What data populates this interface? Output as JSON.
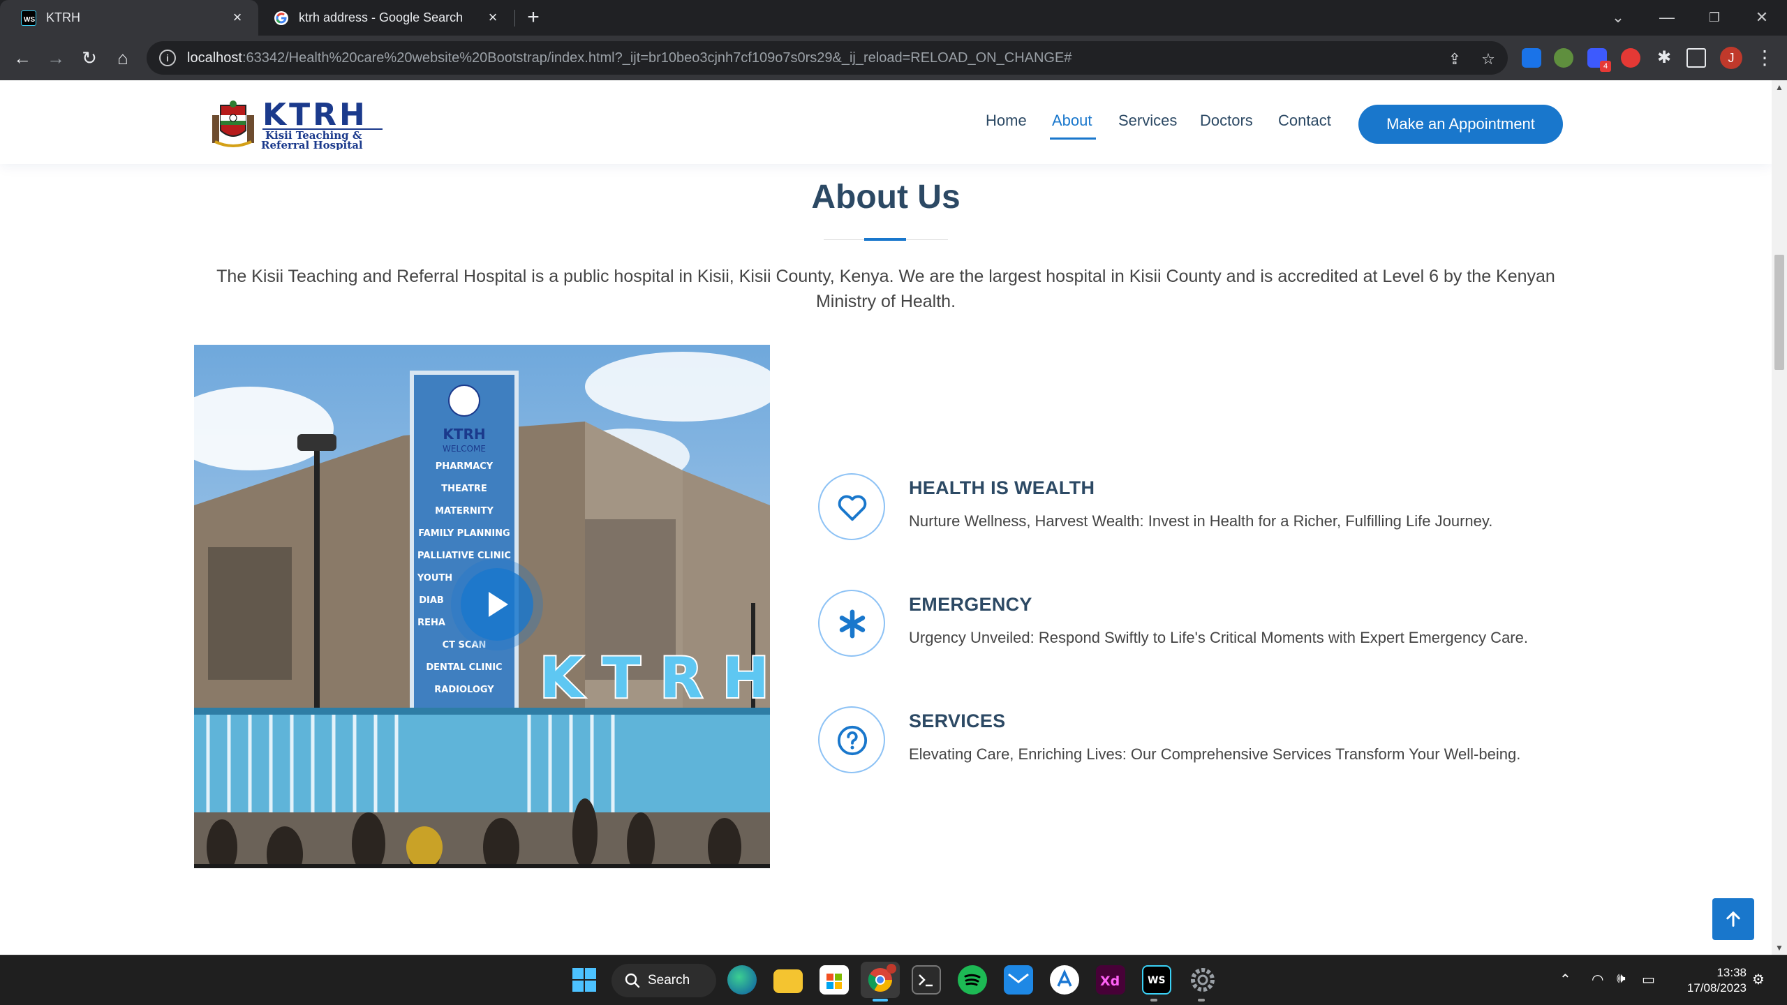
{
  "browser": {
    "tabs": [
      {
        "title": "KTRH",
        "active": true,
        "icon": "webstorm-icon"
      },
      {
        "title": "ktrh address - Google Search",
        "active": false,
        "icon": "google-icon"
      }
    ],
    "url_host": "localhost",
    "url_rest": ":63342/Health%20care%20website%20Bootstrap/index.html?_ijt=br10beo3cjnh7cf109o7s0rs29&_ij_reload=RELOAD_ON_CHANGE#",
    "profile_initial": "J",
    "extension_badge": "4"
  },
  "site": {
    "logo": {
      "name": "KTRH",
      "line1": "Kisii Teaching &",
      "line2": "Referral Hospital"
    },
    "nav": [
      "Home",
      "About",
      "Services",
      "Doctors",
      "Contact"
    ],
    "active_nav": "About",
    "appointment_label": "Make an Appointment",
    "about": {
      "title": "About Us",
      "description": "The Kisii Teaching and Referral Hospital is a public hospital in Kisii, Kisii County, Kenya. We are the largest hospital in Kisii County and is accredited at Level 6 by the Kenyan Ministry of Health."
    },
    "video_photo": {
      "sign_title": "KTRH",
      "sign_welcome": "WELCOME",
      "sign_items": [
        "PHARMACY",
        "THEATRE",
        "MATERNITY",
        "FAMILY PLANNING",
        "PALLIATIVE CLINIC",
        "YOUTH",
        "DIAB",
        "REHA",
        "CT SCAN",
        "DENTAL CLINIC",
        "RADIOLOGY"
      ],
      "overlay_text": "K T R H"
    },
    "features": [
      {
        "title": "HEALTH IS WEALTH",
        "text": "Nurture Wellness, Harvest Wealth: Invest in Health for a Richer, Fulfilling Life Journey.",
        "icon": "heart-icon"
      },
      {
        "title": "EMERGENCY",
        "text": "Urgency Unveiled: Respond Swiftly to Life's Critical Moments with Expert Emergency Care.",
        "icon": "asterisk-icon"
      },
      {
        "title": "SERVICES",
        "text": "Elevating Care, Enriching Lives: Our Comprehensive Services Transform Your Well-being.",
        "icon": "question-circle-icon"
      }
    ]
  },
  "taskbar": {
    "search_label": "Search",
    "time": "13:38",
    "date": "17/08/2023",
    "apps": [
      "start-icon",
      "edge-icon",
      "file-explorer-icon",
      "microsoft-store-icon",
      "chrome-icon",
      "terminal-icon",
      "spotify-icon",
      "mail-icon",
      "app-icon",
      "adobe-xd-icon",
      "webstorm-icon",
      "settings-icon"
    ]
  },
  "colors": {
    "accent": "#1977cc",
    "heading": "#2c4964",
    "text": "#444444"
  }
}
